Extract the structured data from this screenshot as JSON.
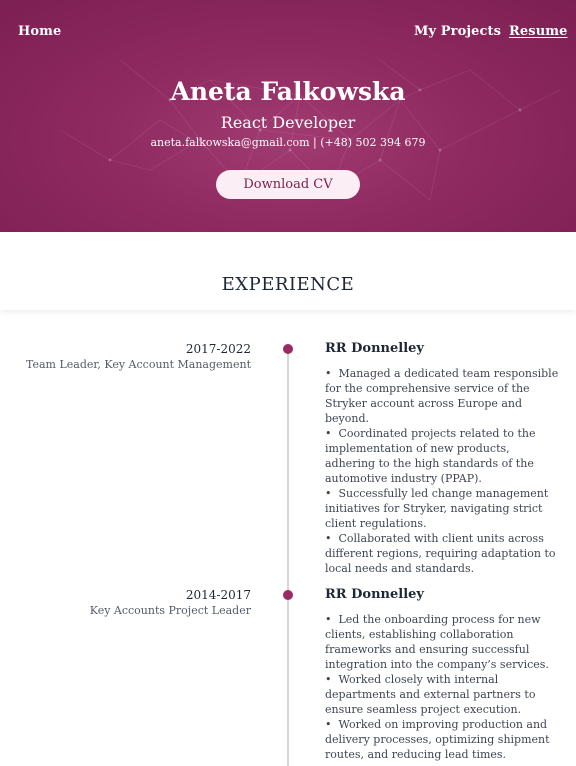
{
  "nav": {
    "home": "Home",
    "projects": "My Projects",
    "resume": "Resume"
  },
  "hero": {
    "name": "Aneta Falkowska",
    "role": "React Developer",
    "contact": "aneta.falkowska@gmail.com | (+48) 502 394 679",
    "download_label": "Download CV"
  },
  "experience": {
    "title": "EXPERIENCE",
    "entries": [
      {
        "years": "2017-2022",
        "position": "Team Leader, Key Account Management",
        "company": "RR Donnelley",
        "bullets": [
          "Managed a dedicated team responsible for the comprehensive service of the Stryker account across Europe and beyond.",
          "Coordinated projects related to the implementation of new products, adhering to the high standards of the automotive industry (PPAP).",
          "Successfully led change management initiatives for Stryker, navigating strict client regulations.",
          "Collaborated with client units across different regions, requiring adaptation to local needs and standards."
        ]
      },
      {
        "years": "2014-2017",
        "position": "Key Accounts Project Leader",
        "company": "RR Donnelley",
        "bullets": [
          "Led the onboarding process for new clients, establishing collaboration frameworks and ensuring successful integration into the company’s services.",
          "Worked closely with internal departments and external partners to ensure seamless project execution.",
          "Worked on improving production and delivery processes, optimizing shipment routes, and reducing lead times."
        ]
      }
    ]
  },
  "colors": {
    "hero": "#8f2a60",
    "accent": "#9b2a63",
    "button_bg": "#fbeef4"
  }
}
